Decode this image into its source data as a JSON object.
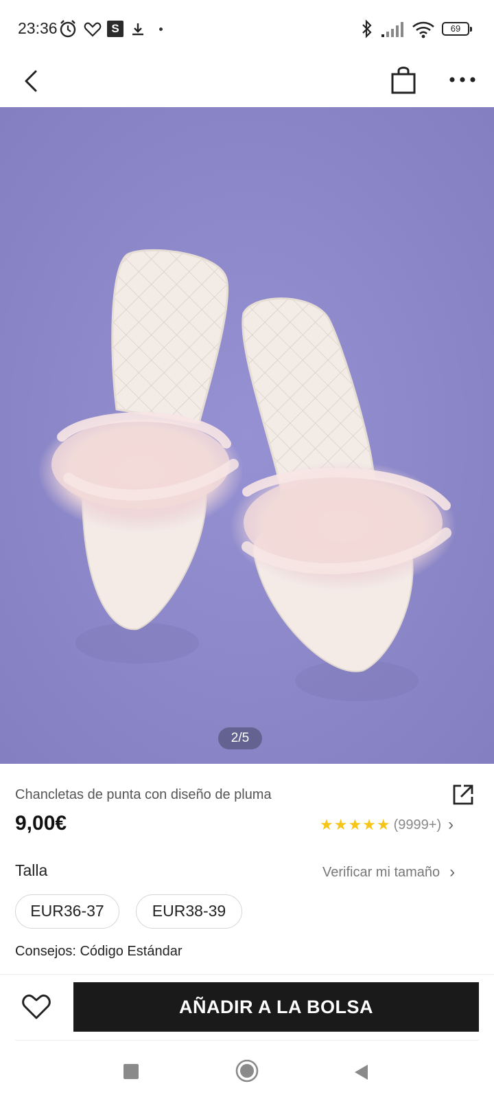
{
  "status_bar": {
    "time": "23:36",
    "s_badge": "S",
    "battery": "69"
  },
  "nav": {
    "back_icon": "back-arrow-icon",
    "bag_icon": "shopping-bag-icon",
    "more_icon": "more-icon"
  },
  "gallery": {
    "counter": "2/5",
    "background": "#8a86c6"
  },
  "product": {
    "title": "Chancletas de punta con diseño de pluma",
    "price": "9,00€",
    "rating_stars": "★★★★★",
    "rating_value": 4.5,
    "rating_count": "(9999+)",
    "rating_chevron": "›"
  },
  "size": {
    "label": "Talla",
    "verify_label": "Verificar mi tamaño",
    "verify_chevron": "›",
    "options": [
      "EUR36-37",
      "EUR38-39"
    ],
    "tips": "Consejos: Código Estándar"
  },
  "actions": {
    "add_to_bag": "AÑADIR A LA BOLSA",
    "button_color": "#1a1a1a"
  }
}
